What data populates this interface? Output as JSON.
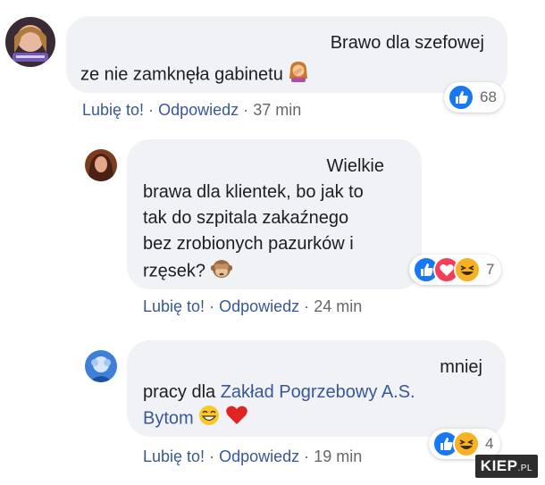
{
  "comments": [
    {
      "lines": [
        "Brawo dla szefowej",
        "ze nie zamknęła gabinetu"
      ],
      "like": "Lubię to!",
      "reply": "Odpowiedz",
      "sep": "·",
      "time": "37 min",
      "reaction_icons": [
        "like-icon"
      ],
      "reaction_count": "68"
    },
    {
      "lines": [
        "Wielkie",
        "brawa dla klientek, bo jak to",
        "tak do szpitala zakaźnego",
        "bez zrobionych pazurków i",
        "rzęsek?"
      ],
      "like": "Lubię to!",
      "reply": "Odpowiedz",
      "sep": "·",
      "time": "24 min",
      "reaction_icons": [
        "like-icon",
        "love-icon",
        "haha-icon"
      ],
      "reaction_count": "7"
    },
    {
      "lines": [
        "mniej",
        "pracy dla",
        "Bytom"
      ],
      "mention_line2": "Zakład Pogrzebowy A.S.",
      "like": "Lubię to!",
      "reply": "Odpowiedz",
      "sep": "·",
      "time": "19 min",
      "reaction_icons": [
        "like-icon",
        "haha-icon"
      ],
      "reaction_count": "4"
    }
  ],
  "watermark": {
    "main": "KIEP",
    "suffix": ".PL"
  },
  "colors": {
    "bubble": "#f0f2f5",
    "link": "#385898",
    "muted": "#65676b",
    "like": "#1877f2",
    "love": "#f33e58",
    "haha": "#f7b125"
  }
}
